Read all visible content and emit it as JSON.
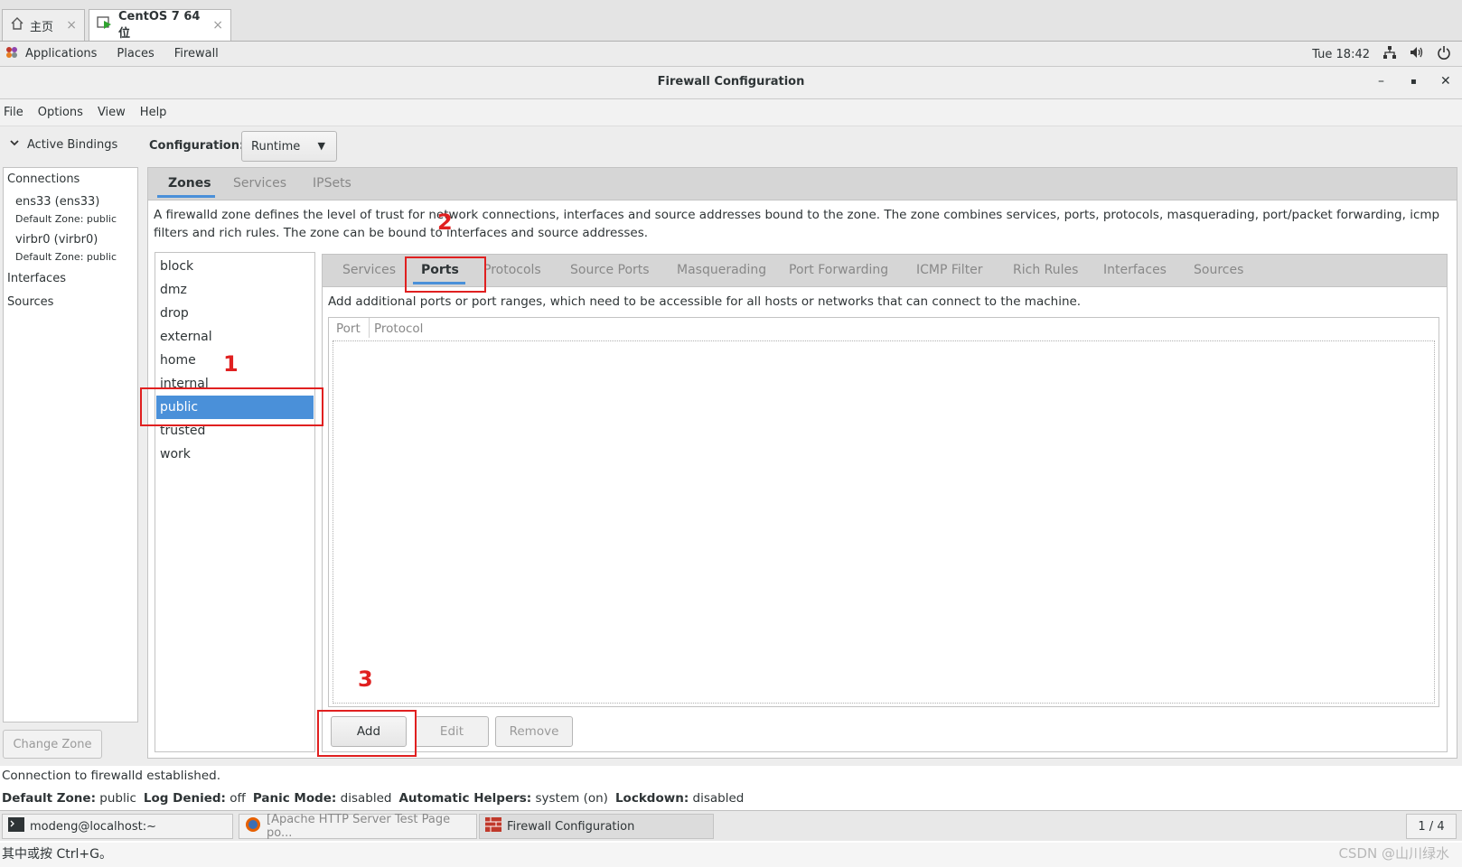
{
  "vm_tabs": [
    {
      "label": "主页",
      "icon": "home-icon"
    },
    {
      "label": "CentOS 7 64 位",
      "icon": "vm-icon"
    }
  ],
  "topbar": {
    "menus": [
      "Applications",
      "Places",
      "Firewall"
    ],
    "clock": "Tue 18:42"
  },
  "window": {
    "title": "Firewall Configuration"
  },
  "menubar": [
    "File",
    "Options",
    "View",
    "Help"
  ],
  "left": {
    "section_title": "Active Bindings",
    "connections_label": "Connections",
    "connections": [
      {
        "name": "ens33 (ens33)",
        "zone": "Default Zone: public"
      },
      {
        "name": "virbr0 (virbr0)",
        "zone": "Default Zone: public"
      }
    ],
    "interfaces_label": "Interfaces",
    "sources_label": "Sources",
    "change_zone": "Change Zone"
  },
  "config": {
    "label": "Configuration:",
    "value": "Runtime"
  },
  "outer_tabs": [
    "Zones",
    "Services",
    "IPSets"
  ],
  "zone_description": "A firewalld zone defines the level of trust for network connections, interfaces and source addresses bound to the zone. The zone combines services, ports, protocols, masquerading, port/packet forwarding, icmp filters and rich rules. The zone can be bound to interfaces and source addresses.",
  "zones": [
    "block",
    "dmz",
    "drop",
    "external",
    "home",
    "internal",
    "public",
    "trusted",
    "work"
  ],
  "selected_zone": "public",
  "inner_tabs": [
    "Services",
    "Ports",
    "Protocols",
    "Source Ports",
    "Masquerading",
    "Port Forwarding",
    "ICMP Filter",
    "Rich Rules",
    "Interfaces",
    "Sources"
  ],
  "ports": {
    "description": "Add additional ports or port ranges, which need to be accessible for all hosts or networks that can connect to the machine.",
    "columns": [
      "Port",
      "Protocol"
    ],
    "rows": [],
    "buttons": {
      "add": "Add",
      "edit": "Edit",
      "remove": "Remove"
    }
  },
  "annotations": [
    "1",
    "2",
    "3"
  ],
  "status": {
    "message": "Connection to firewalld established.",
    "default_zone_label": "Default Zone:",
    "default_zone": "public",
    "log_denied_label": "Log Denied:",
    "log_denied": "off",
    "panic_label": "Panic Mode:",
    "panic": "disabled",
    "helpers_label": "Automatic Helpers:",
    "helpers": "system (on)",
    "lockdown_label": "Lockdown:",
    "lockdown": "disabled"
  },
  "taskbar": {
    "items": [
      "modeng@localhost:~",
      "[Apache HTTP Server Test Page po...",
      "Firewall Configuration"
    ],
    "workspace": "1 / 4"
  },
  "hint": "其中或按 Ctrl+G。",
  "watermark": "CSDN @山川绿水",
  "colors": {
    "accent": "#4a90d9",
    "annotation": "#e02020"
  }
}
